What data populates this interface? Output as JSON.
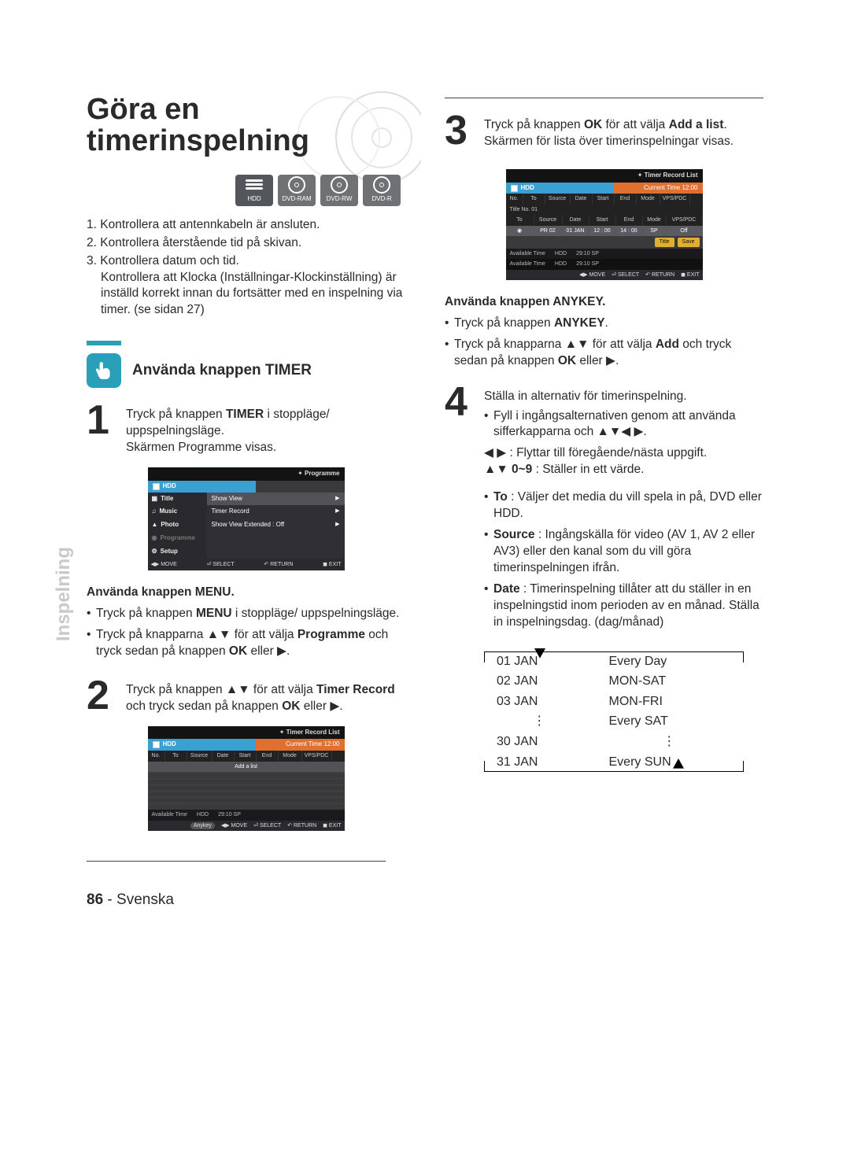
{
  "page": {
    "number": "86",
    "lang": "Svenska"
  },
  "sideLabel": "Inspelning",
  "title": "Göra en timerinspelning",
  "mediaIcons": [
    "HDD",
    "DVD-RAM",
    "DVD-RW",
    "DVD-R"
  ],
  "preChecks": [
    "Kontrollera att antennkabeln är ansluten.",
    "Kontrollera återstående tid på skivan.",
    "Kontrollera datum och tid."
  ],
  "preChecksNote": "Kontrollera att Klocka (Inställningar-Klockinställning) är inställd korrekt innan du fortsätter med en inspelning via timer. (se sidan 27)",
  "section1": {
    "title": "Använda knappen TIMER"
  },
  "step1": {
    "num": "1",
    "line1a": "Tryck på knappen ",
    "line1b": "TIMER",
    "line1c": " i stoppläge/ uppspelningsläge.",
    "line2": "Skärmen Programme visas."
  },
  "osd1": {
    "topTitle": "Programme",
    "hdd": "HDD",
    "side": [
      "Title",
      "Music",
      "Photo",
      "Programme",
      "Setup"
    ],
    "main": [
      {
        "label": "Show View",
        "arrow": true,
        "sel": true
      },
      {
        "label": "Timer Record",
        "arrow": true
      },
      {
        "label": "Show View Extended : Off",
        "arrow": true
      }
    ],
    "footer": [
      "◀▶ MOVE",
      "⏎ SELECT",
      "↶ RETURN",
      "◼ EXIT"
    ]
  },
  "menuBlock": {
    "head": "Använda knappen MENU.",
    "b1a": "Tryck på knappen ",
    "b1b": "MENU",
    "b1c": " i stoppläge/ uppspelningsläge.",
    "b2a": "Tryck på knapparna ▲▼ för att välja ",
    "b2b": "Programme",
    "b2c": " och tryck sedan på knappen ",
    "b2d": "OK",
    "b2e": " eller ▶."
  },
  "step2": {
    "num": "2",
    "a": "Tryck på knappen ▲▼ för att välja ",
    "b": "Timer Record",
    "c": " och tryck sedan på knappen ",
    "d": "OK",
    "e": " eller ▶."
  },
  "osd2": {
    "topTitle": "Timer Record List",
    "hdd": "HDD",
    "ct": "Current Time 12:00",
    "cols": [
      "No.",
      "To",
      "Source",
      "Date",
      "Start",
      "End",
      "Mode",
      "VPS/PDC"
    ],
    "addRow": "Add a list",
    "avail": {
      "label": "Available Time",
      "dev": "HDD",
      "val": "29:10 SP"
    },
    "footer": [
      "Anykey",
      "◀▶ MOVE",
      "⏎ SELECT",
      "↶ RETURN",
      "◼ EXIT"
    ]
  },
  "step3": {
    "num": "3",
    "a": "Tryck på knappen ",
    "b": "OK",
    "c": " för att välja ",
    "d": "Add a list",
    "e": ".",
    "line2": "Skärmen för lista över timerinspelningar visas."
  },
  "osd3": {
    "topTitle": "Timer Record List",
    "hdd": "HDD",
    "ct": "Current Time 12:00",
    "cols": [
      "No.",
      "To",
      "Source",
      "Date",
      "Start",
      "End",
      "Mode",
      "VPS/PDC"
    ],
    "titleNo": "Title No. 01",
    "row2cols": [
      "To",
      "Source",
      "Date",
      "Start",
      "End",
      "Mode",
      "VPS/PDC"
    ],
    "dataRow": [
      "",
      "PR 02",
      "01 JAN",
      "12 : 00",
      "14 : 00",
      "SP",
      "Off"
    ],
    "btns": [
      "Title",
      "Save"
    ],
    "avail": {
      "label": "Available Time",
      "dev": "HDD",
      "val": "29:10 SP"
    },
    "avail2": {
      "label": "Available Time",
      "dev": "HDD",
      "val": "29:10 SP"
    },
    "footer": [
      "◀▶ MOVE",
      "⏎ SELECT",
      "↶ RETURN",
      "◼ EXIT"
    ]
  },
  "anykeyBlock": {
    "head": "Använda knappen ANYKEY.",
    "b1a": "Tryck på knappen ",
    "b1b": "ANYKEY",
    "b1c": ".",
    "b2a": "Tryck på knapparna ▲▼ för att välja ",
    "b2b": "Add",
    "b2c": " och tryck sedan på knappen ",
    "b2d": "OK",
    "b2e": " eller ▶."
  },
  "step4": {
    "num": "4",
    "line1": "Ställa in alternativ för timerinspelning.",
    "b1": "Fyll i ingångsalternativen genom att använda sifferkapparna och ▲▼◀ ▶.",
    "navLine": "◀ ▶ : Flyttar till föregående/nästa uppgift.",
    "navLine2a": "▲▼ 0~9",
    "navLine2b": " : Ställer in ett värde.",
    "b2a": "To",
    "b2b": " : Väljer det media du vill spela in på, DVD eller HDD.",
    "b3a": "Source",
    "b3b": " : Ingångskälla för video (AV 1, AV 2 eller AV3) eller den kanal som du vill göra timerinspelningen ifrån.",
    "b4a": "Date",
    "b4b": " : Timerinspelning tillåter att du ställer in en inspelningstid inom perioden av en månad. Ställa in inspelningsdag. (dag/månad)"
  },
  "dateTable": {
    "left": [
      "01 JAN",
      "02 JAN",
      "03 JAN",
      "⋮",
      "30 JAN",
      "31 JAN"
    ],
    "right": [
      "Every Day",
      "MON-SAT",
      "MON-FRI",
      "Every SAT",
      "⋮",
      "Every SUN"
    ]
  }
}
